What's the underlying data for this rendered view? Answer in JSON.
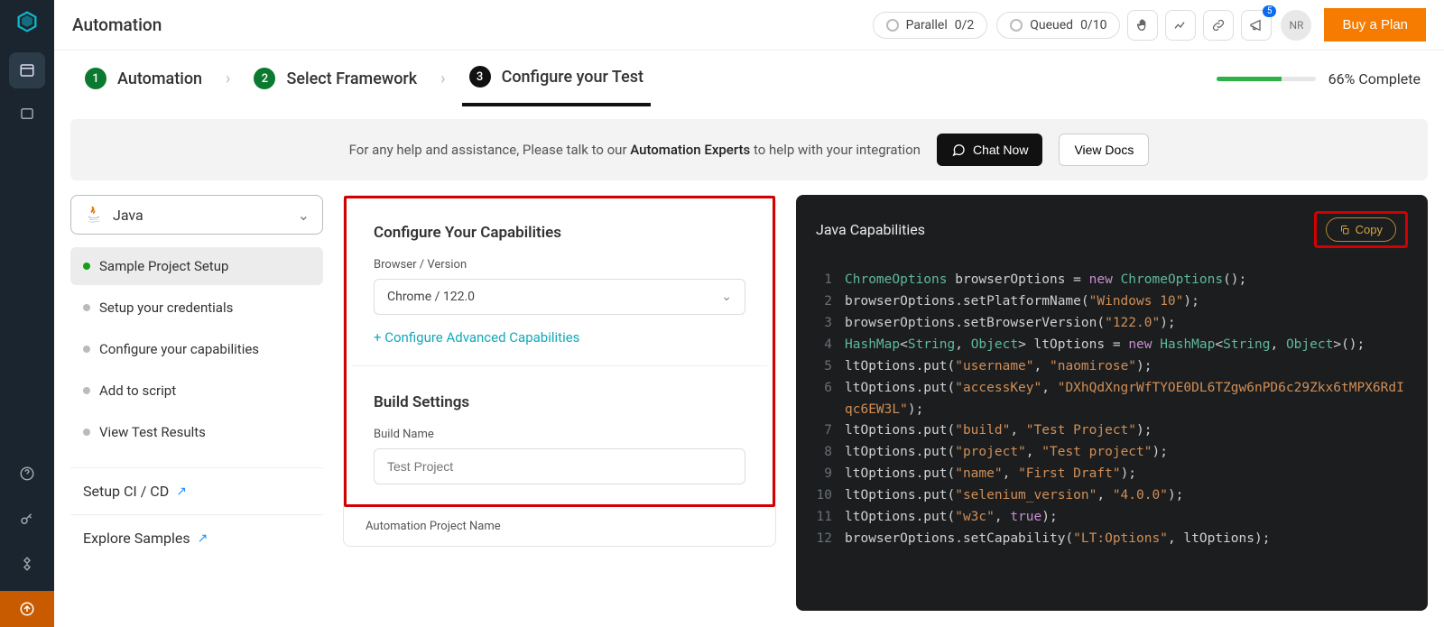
{
  "topbar": {
    "title": "Automation",
    "parallel_label": "Parallel",
    "parallel_count": "0/2",
    "queued_label": "Queued",
    "queued_count": "0/10",
    "notification_badge": "5",
    "avatar": "NR",
    "buy_label": "Buy a Plan"
  },
  "stepper": {
    "steps": [
      {
        "num": "1",
        "label": "Automation"
      },
      {
        "num": "2",
        "label": "Select Framework"
      },
      {
        "num": "3",
        "label": "Configure your Test"
      }
    ],
    "progress_label": "66% Complete",
    "progress_pct": 66
  },
  "help": {
    "prefix": "For any help and assistance, Please talk to our ",
    "experts": "Automation Experts",
    "suffix": " to help with your integration",
    "chat_label": "Chat Now",
    "docs_label": "View Docs"
  },
  "left": {
    "language": "Java",
    "items": [
      "Sample Project Setup",
      "Setup your credentials",
      "Configure your capabilities",
      "Add to script",
      "View Test Results"
    ],
    "ci_label": "Setup CI / CD",
    "samples_label": "Explore Samples"
  },
  "config": {
    "cap_title": "Configure Your Capabilities",
    "browser_label": "Browser / Version",
    "browser_value": "Chrome / 122.0",
    "adv_label": "+ Configure Advanced Capabilities",
    "build_title": "Build Settings",
    "buildname_label": "Build Name",
    "buildname_placeholder": "Test Project",
    "projectname_label": "Automation Project Name"
  },
  "code": {
    "title": "Java Capabilities",
    "copy_label": "Copy",
    "lines": [
      {
        "n": "1",
        "html": "<span class='c-type'>ChromeOptions</span> browserOptions = <span class='c-kw'>new</span> <span class='c-type'>ChromeOptions</span>();"
      },
      {
        "n": "2",
        "html": "browserOptions.setPlatformName(<span class='c-str'>\"Windows 10\"</span>);"
      },
      {
        "n": "3",
        "html": "browserOptions.setBrowserVersion(<span class='c-str'>\"122.0\"</span>);"
      },
      {
        "n": "4",
        "html": "<span class='c-type'>HashMap</span>&lt;<span class='c-type'>String</span>, <span class='c-type'>Object</span>&gt; ltOptions = <span class='c-kw'>new</span> <span class='c-type'>HashMap</span>&lt;<span class='c-type'>String</span>, <span class='c-type'>Object</span>&gt;();"
      },
      {
        "n": "5",
        "html": "ltOptions.put(<span class='c-str'>\"username\"</span>, <span class='c-str'>\"naomirose\"</span>);"
      },
      {
        "n": "6",
        "html": "ltOptions.put(<span class='c-str'>\"accessKey\"</span>, <span class='c-str'>\"DXhQdXngrWfTYOE0DL6TZgw6nPD6c29Zkx6tMPX6RdIqc6EW3L\"</span>);"
      },
      {
        "n": "7",
        "html": "ltOptions.put(<span class='c-str'>\"build\"</span>, <span class='c-str'>\"Test Project\"</span>);"
      },
      {
        "n": "8",
        "html": "ltOptions.put(<span class='c-str'>\"project\"</span>, <span class='c-str'>\"Test project\"</span>);"
      },
      {
        "n": "9",
        "html": "ltOptions.put(<span class='c-str'>\"name\"</span>, <span class='c-str'>\"First Draft\"</span>);"
      },
      {
        "n": "10",
        "html": "ltOptions.put(<span class='c-str'>\"selenium_version\"</span>, <span class='c-str'>\"4.0.0\"</span>);"
      },
      {
        "n": "11",
        "html": "ltOptions.put(<span class='c-str'>\"w3c\"</span>, <span class='c-bool'>true</span>);"
      },
      {
        "n": "12",
        "html": "browserOptions.setCapability(<span class='c-str'>\"LT:Options\"</span>, ltOptions);"
      }
    ]
  }
}
